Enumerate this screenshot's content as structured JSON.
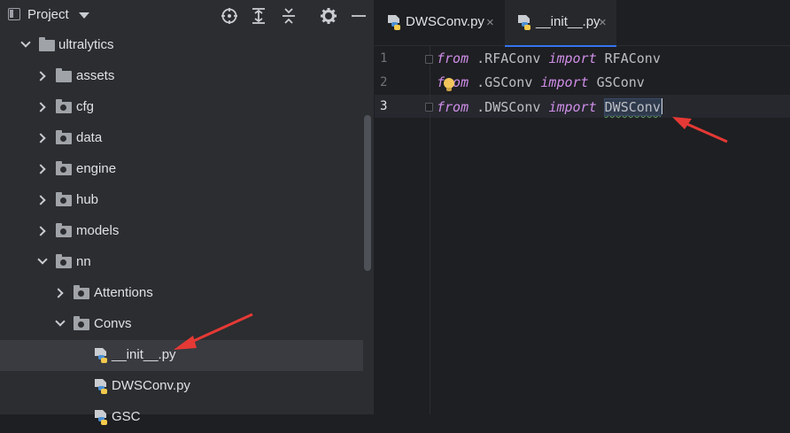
{
  "colors": {
    "accent": "#3574f0",
    "keyword": "#cf8ee8",
    "arrow": "#e53935"
  },
  "sidebar": {
    "title": "Project",
    "toolbar_icons": [
      "locate-icon",
      "expand-all-icon",
      "collapse-all-icon",
      "settings-icon",
      "minimize-icon"
    ],
    "tree": [
      {
        "label": "ultralytics",
        "kind": "folder",
        "state": "expanded"
      },
      {
        "label": "assets",
        "kind": "folder",
        "state": "collapsed"
      },
      {
        "label": "cfg",
        "kind": "package",
        "state": "collapsed"
      },
      {
        "label": "data",
        "kind": "package",
        "state": "collapsed"
      },
      {
        "label": "engine",
        "kind": "package",
        "state": "collapsed"
      },
      {
        "label": "hub",
        "kind": "package",
        "state": "collapsed"
      },
      {
        "label": "models",
        "kind": "package",
        "state": "collapsed"
      },
      {
        "label": "nn",
        "kind": "package",
        "state": "expanded"
      },
      {
        "label": "Attentions",
        "kind": "package",
        "state": "collapsed"
      },
      {
        "label": "Convs",
        "kind": "package",
        "state": "expanded"
      },
      {
        "label": "__init__.py",
        "kind": "python-file",
        "selected": true
      },
      {
        "label": "DWSConv.py",
        "kind": "python-file"
      },
      {
        "label": "GSC",
        "kind": "python-file"
      }
    ]
  },
  "editor": {
    "tabs": [
      {
        "label": "DWSConv.py",
        "close": "×",
        "active": false
      },
      {
        "label": "__init__.py",
        "close": "×",
        "active": true
      }
    ],
    "lines": [
      {
        "number": "1",
        "from": "from",
        "module": " .RFAConv ",
        "import": "import",
        "name": "RFAConv"
      },
      {
        "number": "2",
        "from": "from",
        "module": " .GSConv ",
        "import": "import",
        "name": "GSConv"
      },
      {
        "number": "3",
        "from": "from",
        "module": " .DWSConv ",
        "import": "import",
        "name": "DWSConv"
      }
    ],
    "current_line": "3"
  }
}
